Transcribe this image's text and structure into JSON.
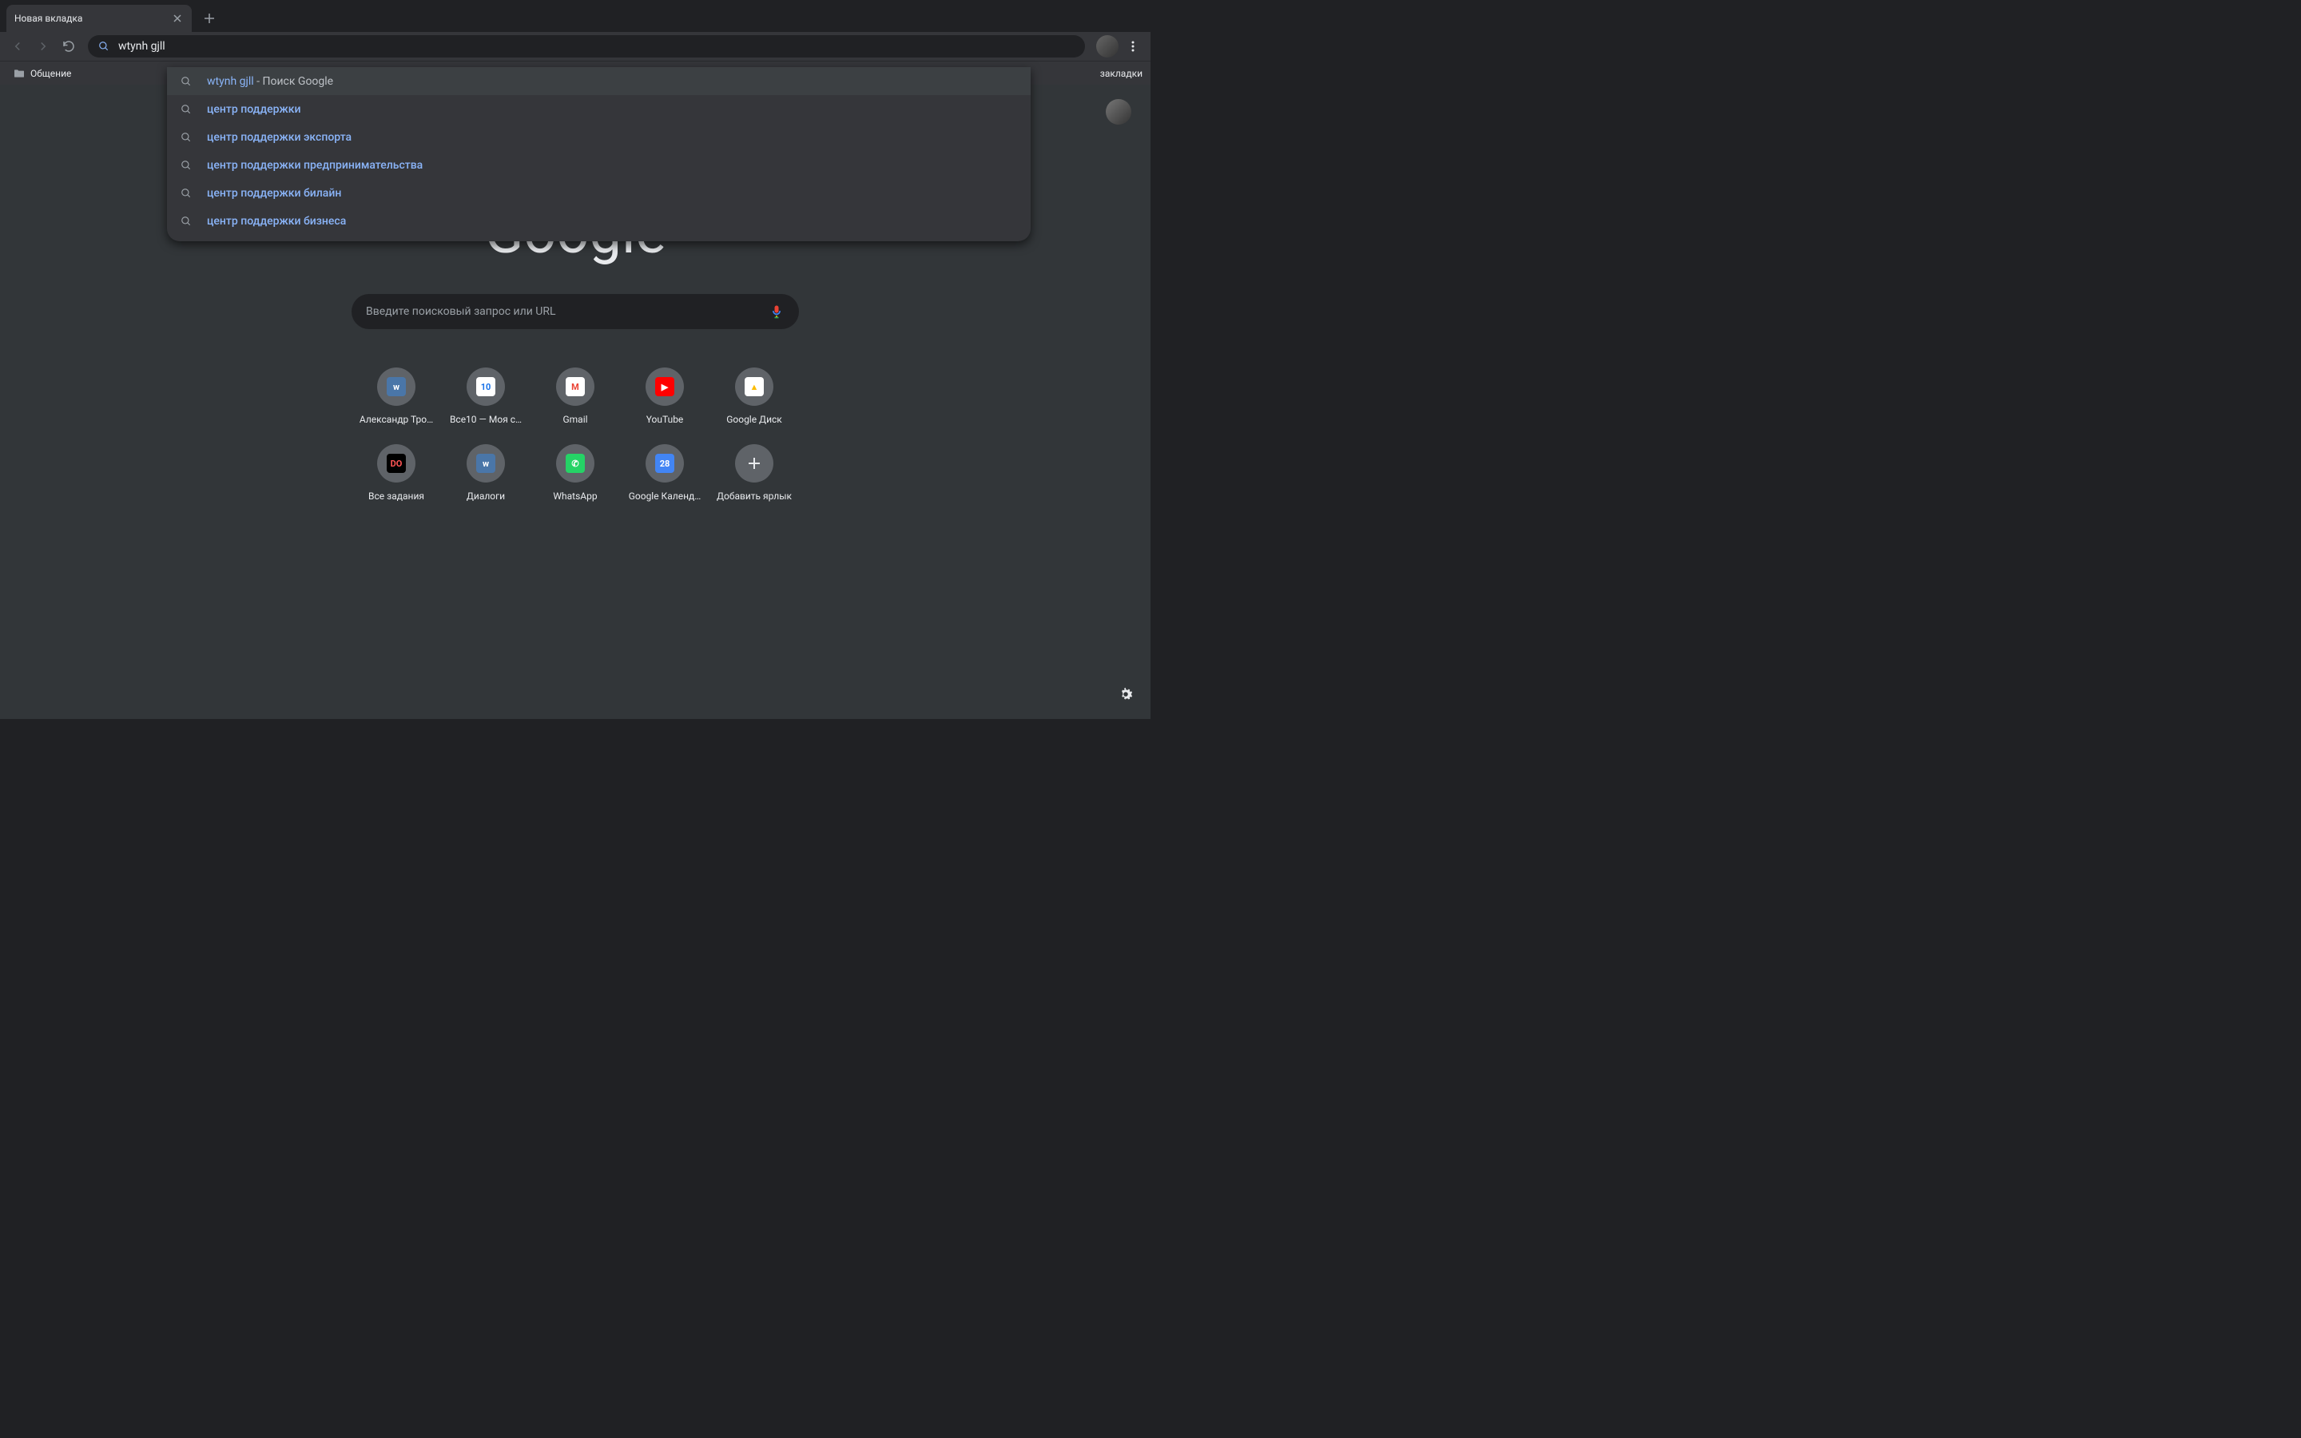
{
  "tab": {
    "title": "Новая вкладка"
  },
  "bookmarks": {
    "folder": "Общение",
    "other": "закладки"
  },
  "omnibox": {
    "value": "wtynh gjll"
  },
  "suggestions": [
    {
      "typed": "wtynh gjll",
      "hint": " - Поиск Google",
      "selected": true,
      "highlight": false
    },
    {
      "text": "центр поддержки",
      "highlight": true
    },
    {
      "text": "центр поддержки экспорта",
      "highlight": true
    },
    {
      "text": "центр поддержки предпринимательства",
      "highlight": true
    },
    {
      "text": "центр поддержки билайн",
      "highlight": true
    },
    {
      "text": "центр поддержки бизнеса",
      "highlight": true
    }
  ],
  "search": {
    "placeholder": "Введите поисковый запрос или URL"
  },
  "shortcuts": [
    {
      "label": "Александр Тро…",
      "icon_bg": "#4a76a8",
      "icon_text": "w",
      "icon_color": "#ffffff"
    },
    {
      "label": "Все10 — Моя с…",
      "icon_bg": "#ffffff",
      "icon_text": "10",
      "icon_color": "#1a73e8"
    },
    {
      "label": "Gmail",
      "icon_bg": "#ffffff",
      "icon_text": "M",
      "icon_color": "#ea4335"
    },
    {
      "label": "YouTube",
      "icon_bg": "#ff0000",
      "icon_text": "▶",
      "icon_color": "#ffffff"
    },
    {
      "label": "Google Диск",
      "icon_bg": "#ffffff",
      "icon_text": "▲",
      "icon_color": "#fbbc04"
    },
    {
      "label": "Все задания",
      "icon_bg": "#000000",
      "icon_text": "DO",
      "icon_color": "#ff5555"
    },
    {
      "label": "Диалоги",
      "icon_bg": "#4a76a8",
      "icon_text": "w",
      "icon_color": "#ffffff"
    },
    {
      "label": "WhatsApp",
      "icon_bg": "#25d366",
      "icon_text": "✆",
      "icon_color": "#ffffff"
    },
    {
      "label": "Google Календ…",
      "icon_bg": "#4285f4",
      "icon_text": "28",
      "icon_color": "#ffffff"
    },
    {
      "label": "Добавить ярлык",
      "add": true
    }
  ]
}
